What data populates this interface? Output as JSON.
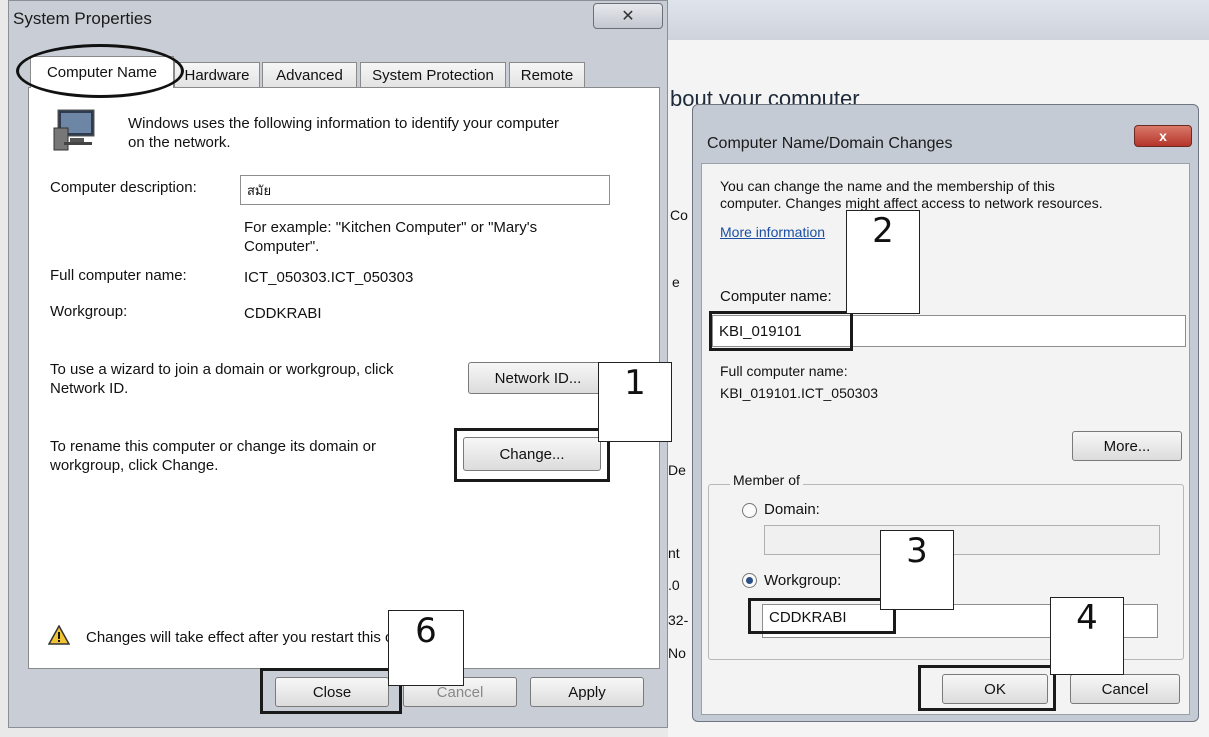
{
  "system_properties": {
    "title": "System Properties",
    "tabs": [
      "Computer Name",
      "Hardware",
      "Advanced",
      "System Protection",
      "Remote"
    ],
    "intro_line1": "Windows uses the following information to identify your computer",
    "intro_line2": "on the network.",
    "description_label": "Computer description:",
    "description_value": "สมัย",
    "example_line1": "For example: \"Kitchen Computer\" or \"Mary's",
    "example_line2": "Computer\".",
    "full_name_label": "Full computer name:",
    "full_name_value": "ICT_050303.ICT_050303",
    "workgroup_label": "Workgroup:",
    "workgroup_value": "CDDKRABI",
    "network_text_line1": "To use a wizard to join a domain or workgroup, click",
    "network_text_line2": "Network ID.",
    "network_id_button": "Network ID...",
    "rename_text_line1": "To rename this computer or change its domain or",
    "rename_text_line2": "workgroup, click Change.",
    "change_button": "Change...",
    "warning_text": "Changes will take effect after you restart this computer.",
    "close_button": "Close",
    "cancel_button": "Cancel",
    "apply_button": "Apply"
  },
  "background_window": {
    "heading": "bout your computer",
    "side_fragments": [
      "Co",
      "e",
      "De",
      "nt",
      ".0",
      "32-",
      "No"
    ]
  },
  "domain_changes": {
    "title": "Computer Name/Domain Changes",
    "close_glyph": "x",
    "intro_line1": "You can change the name and the membership of this",
    "intro_line2": "computer. Changes might affect access to network resources.",
    "more_info_link": "More information",
    "computer_name_label": "Computer name:",
    "computer_name_value": "KBI_019101",
    "full_name_label": "Full computer name:",
    "full_name_value": "KBI_019101.ICT_050303",
    "more_button": "More...",
    "member_of_label": "Member of",
    "domain_option": "Domain:",
    "domain_value": "",
    "workgroup_option": "Workgroup:",
    "workgroup_value": "CDDKRABI",
    "ok_button": "OK",
    "cancel_button": "Cancel"
  },
  "step_markers": [
    "1",
    "2",
    "3",
    "4",
    "6"
  ]
}
